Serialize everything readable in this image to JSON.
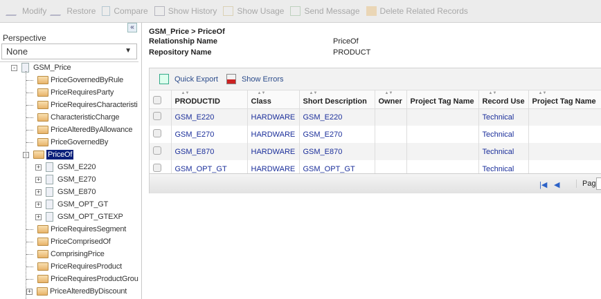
{
  "toolbar": {
    "items": [
      "Modify",
      "Restore",
      "Compare",
      "Show History",
      "Show Usage",
      "Send Message",
      "Delete Related Records"
    ]
  },
  "left": {
    "collapse": "«",
    "perspective_label": "Perspective",
    "perspective_value": "None",
    "tree": {
      "root": "GSM_Price",
      "children_before": [
        "PriceGovernedByRule",
        "PriceRequiresParty",
        "PriceRequiresCharacteristi",
        "CharacteristicCharge",
        "PriceAlteredByAllowance",
        "PriceGovernedBy"
      ],
      "selected": "PriceOf",
      "selected_children": [
        "GSM_E220",
        "GSM_E270",
        "GSM_E870",
        "GSM_OPT_GT",
        "GSM_OPT_GTEXP"
      ],
      "children_after": [
        "PriceRequiresSegment",
        "PriceComprisedOf",
        "ComprisingPrice",
        "PriceRequiresProduct",
        "PriceRequiresProductGrou",
        "PriceAlteredByDiscount"
      ]
    }
  },
  "main": {
    "breadcrumb": "GSM_Price > PriceOf",
    "rel_label": "Relationship Name",
    "rel_value": "PriceOf",
    "repo_label": "Repository Name",
    "repo_value": "PRODUCT",
    "grid": {
      "quick_export": "Quick Export",
      "show_errors": "Show Errors",
      "columns": [
        "PRODUCTID",
        "Class",
        "Short Description",
        "Owner",
        "Project Tag Name",
        "Record Use",
        "Project Tag Name"
      ],
      "rows": [
        [
          "GSM_E220",
          "HARDWARE",
          "GSM_E220",
          "",
          "",
          "Technical",
          ""
        ],
        [
          "GSM_E270",
          "HARDWARE",
          "GSM_E270",
          "",
          "",
          "Technical",
          ""
        ],
        [
          "GSM_E870",
          "HARDWARE",
          "GSM_E870",
          "",
          "",
          "Technical",
          ""
        ],
        [
          "GSM_OPT_GT",
          "HARDWARE",
          "GSM_OPT_GT",
          "",
          "",
          "Technical",
          ""
        ]
      ],
      "page_label": "Page"
    }
  }
}
